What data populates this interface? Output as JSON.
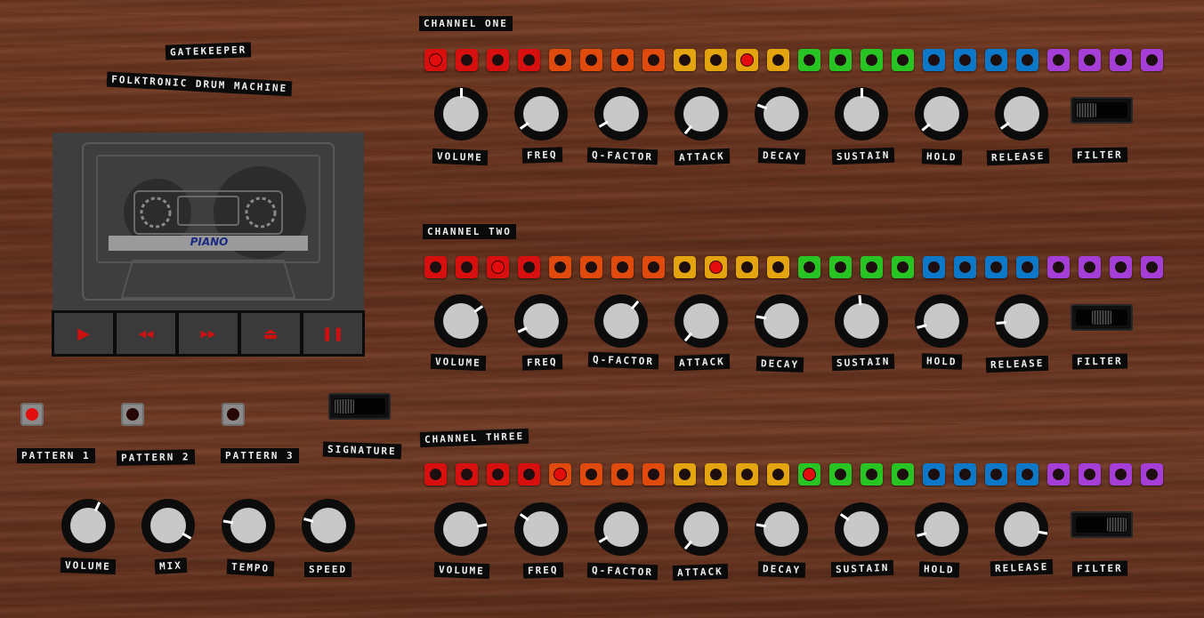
{
  "header": {
    "title": "GATEKEEPER",
    "subtitle": "FOLKTRONIC DRUM MACHINE"
  },
  "cassette": {
    "label": "PIANO"
  },
  "transport": [
    {
      "icon": "play-icon",
      "glyph": "▶"
    },
    {
      "icon": "rewind-icon",
      "glyph": "◀◀"
    },
    {
      "icon": "fast-forward-icon",
      "glyph": "▶▶"
    },
    {
      "icon": "eject-icon",
      "glyph": "⏏"
    },
    {
      "icon": "pause-icon",
      "glyph": "❚❚"
    }
  ],
  "patterns": [
    {
      "label": "PATTERN 1",
      "active": true
    },
    {
      "label": "PATTERN 2",
      "active": false
    },
    {
      "label": "PATTERN 3",
      "active": false
    }
  ],
  "signature": {
    "label": "SIGNATURE",
    "position": "left"
  },
  "master_knobs": [
    {
      "label": "VOLUME",
      "angle": 25
    },
    {
      "label": "MIX",
      "angle": 120
    },
    {
      "label": "TEMPO",
      "angle": -80
    },
    {
      "label": "SPEED",
      "angle": -75
    }
  ],
  "step_colors": [
    "#d80f0f",
    "#d80f0f",
    "#d80f0f",
    "#d80f0f",
    "#e04a0d",
    "#e04a0d",
    "#e04a0d",
    "#e04a0d",
    "#e3a40f",
    "#e3a40f",
    "#e3a40f",
    "#e3a40f",
    "#28c424",
    "#28c424",
    "#28c424",
    "#28c424",
    "#0e78c8",
    "#0e78c8",
    "#0e78c8",
    "#0e78c8",
    "#a43ed6",
    "#a43ed6",
    "#a43ed6",
    "#a43ed6"
  ],
  "channels": [
    {
      "label": "CHANNEL ONE",
      "steps": [
        1,
        0,
        0,
        0,
        0,
        0,
        0,
        0,
        0,
        0,
        1,
        0,
        0,
        0,
        0,
        0,
        0,
        0,
        0,
        0,
        0,
        0,
        0,
        0
      ],
      "knobs": [
        {
          "label": "VOLUME",
          "angle": 0
        },
        {
          "label": "FREQ",
          "angle": -125
        },
        {
          "label": "Q-FACTOR",
          "angle": -120
        },
        {
          "label": "ATTACK",
          "angle": -140
        },
        {
          "label": "DECAY",
          "angle": -70
        },
        {
          "label": "SUSTAIN",
          "angle": 0
        },
        {
          "label": "HOLD",
          "angle": -130
        },
        {
          "label": "RELEASE",
          "angle": -125
        }
      ],
      "filter": {
        "label": "FILTER",
        "position": "left"
      }
    },
    {
      "label": "CHANNEL TWO",
      "steps": [
        0,
        0,
        1,
        0,
        0,
        0,
        0,
        0,
        0,
        1,
        0,
        0,
        0,
        0,
        0,
        0,
        0,
        0,
        0,
        0,
        0,
        0,
        0,
        0
      ],
      "knobs": [
        {
          "label": "VOLUME",
          "angle": 55
        },
        {
          "label": "FREQ",
          "angle": -115
        },
        {
          "label": "Q-FACTOR",
          "angle": 40
        },
        {
          "label": "ATTACK",
          "angle": -140
        },
        {
          "label": "DECAY",
          "angle": -80
        },
        {
          "label": "SUSTAIN",
          "angle": -5
        },
        {
          "label": "HOLD",
          "angle": -105
        },
        {
          "label": "RELEASE",
          "angle": -95
        }
      ],
      "filter": {
        "label": "FILTER",
        "position": "center"
      }
    },
    {
      "label": "CHANNEL THREE",
      "steps": [
        0,
        0,
        0,
        0,
        1,
        0,
        0,
        0,
        0,
        0,
        0,
        0,
        1,
        0,
        0,
        0,
        0,
        0,
        0,
        0,
        0,
        0,
        0,
        0
      ],
      "knobs": [
        {
          "label": "VOLUME",
          "angle": 80
        },
        {
          "label": "FREQ",
          "angle": -55
        },
        {
          "label": "Q-FACTOR",
          "angle": -120
        },
        {
          "label": "ATTACK",
          "angle": -140
        },
        {
          "label": "DECAY",
          "angle": -80
        },
        {
          "label": "SUSTAIN",
          "angle": -55
        },
        {
          "label": "HOLD",
          "angle": -105
        },
        {
          "label": "RELEASE",
          "angle": 100
        }
      ],
      "filter": {
        "label": "FILTER",
        "position": "right"
      }
    }
  ]
}
